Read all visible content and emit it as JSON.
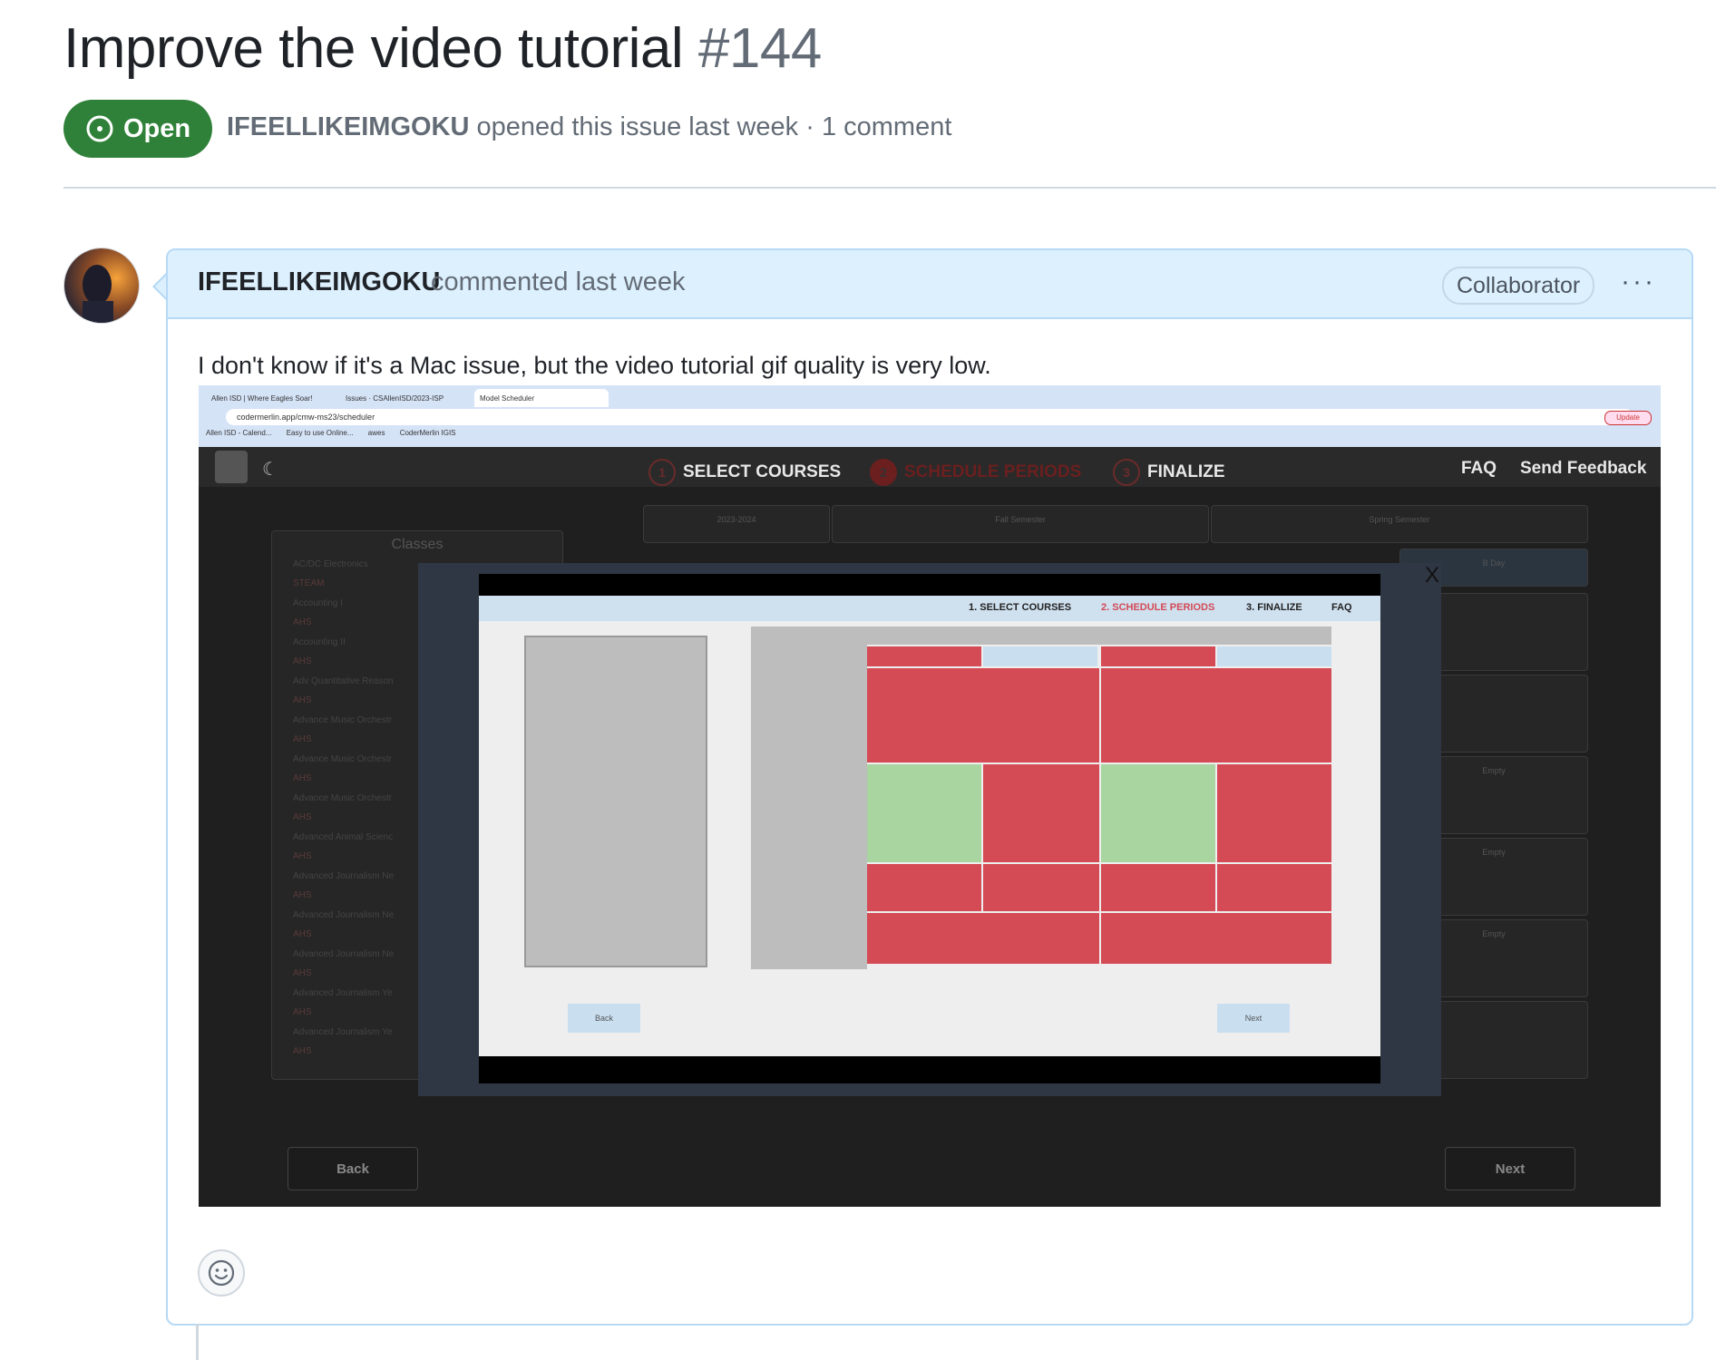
{
  "issue": {
    "title": "Improve the video tutorial",
    "number": "#144",
    "state": "Open",
    "author": "IFEELLIKEIMGOKU",
    "meta_text": "opened this issue last week · 1 comment"
  },
  "comment": {
    "author": "IFEELLIKEIMGOKU",
    "time": "commented last week",
    "role": "Collaborator",
    "menu": "···",
    "body": "I don't know if it's a Mac issue, but the video tutorial gif quality is very low."
  },
  "screenshot": {
    "tabs": [
      "Allen ISD | Where Eagles Soar!",
      "Issues · CSAllenISD/2023-ISP",
      "Model Scheduler"
    ],
    "url": "codermerlin.app/cmw-ms23/scheduler",
    "bookmarks": [
      "Allen ISD - Calend...",
      "Easy to use Online...",
      "awes",
      "CoderMerlin IGIS"
    ],
    "update_label": "Update",
    "steps": [
      {
        "n": "1",
        "label": "SELECT COURSES"
      },
      {
        "n": "2",
        "label": "SCHEDULE PERIODS"
      },
      {
        "n": "3",
        "label": "FINALIZE"
      }
    ],
    "faq": "FAQ",
    "feedback": "Send Feedback",
    "classes_title": "Classes",
    "classes": [
      "AC/DC Electronics",
      "Accounting I",
      "Accounting II",
      "Adv Quantitative Reason",
      "Advance Music Orchestr",
      "Advance Music Orchestr",
      "Advance Music Orchestr",
      "Advanced Animal Scienc",
      "Advanced Journalism Ne",
      "Advanced Journalism Ne",
      "Advanced Journalism Ne",
      "Advanced Journalism Ye",
      "Advanced Journalism Ye"
    ],
    "class_tags": [
      "STEAM",
      "AHS"
    ],
    "year_label": "2023-2024",
    "fall": "Fall Semester",
    "spring": "Spring Semester",
    "a_day": "A Day",
    "b_day": "B Day",
    "empty": "Empty",
    "back": "Back",
    "next": "Next",
    "close": "X",
    "modal_steps": [
      "1. SELECT COURSES",
      "2. SCHEDULE PERIODS",
      "3. FINALIZE",
      "FAQ"
    ],
    "modal_back": "Back",
    "modal_next": "Next"
  }
}
